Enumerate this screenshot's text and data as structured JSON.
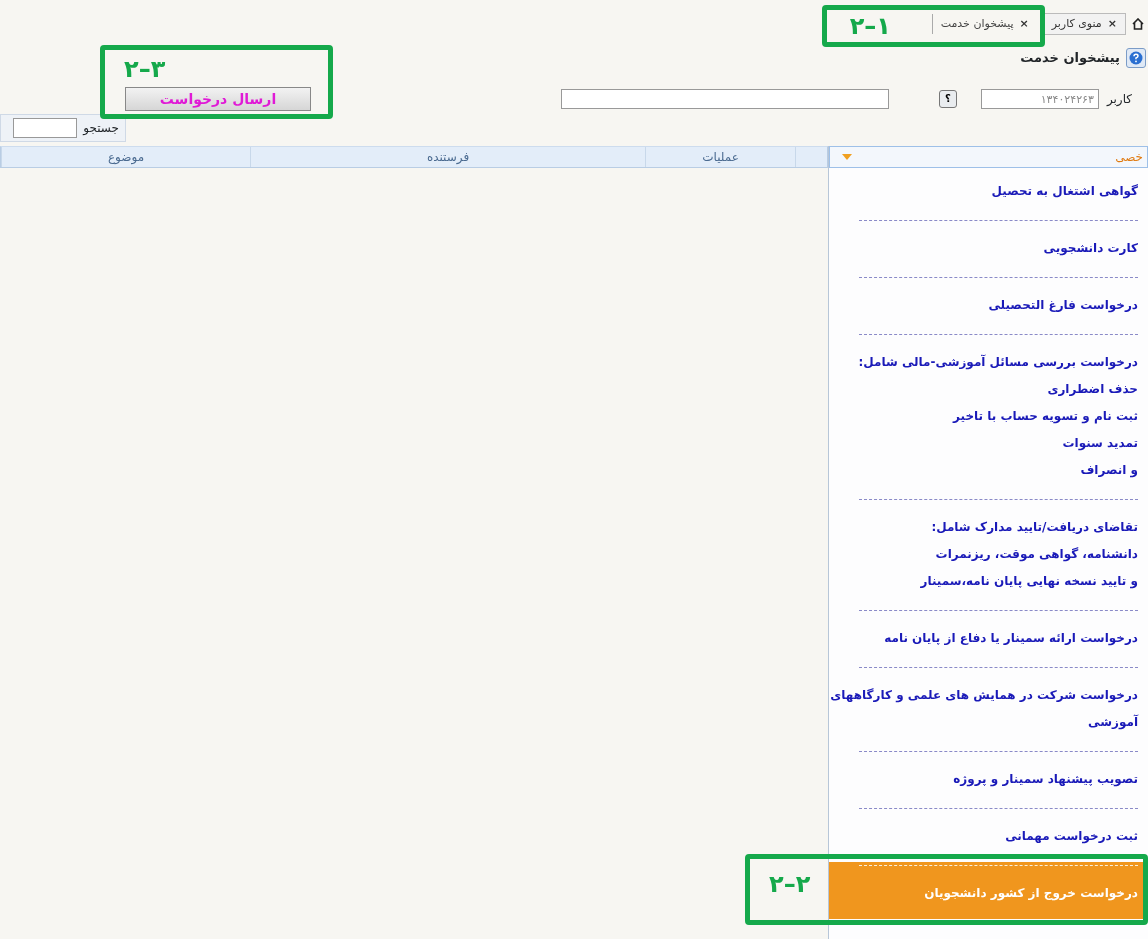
{
  "tabs": [
    {
      "label": "منوی کاربر",
      "close_glyph": "×",
      "selected": false
    },
    {
      "label": "پیشخوان خدمت",
      "close_glyph": "×",
      "selected": true
    }
  ],
  "tabs_annotation": "۲–۱",
  "page_title": "پیشخوان خدمت",
  "user_field": {
    "label": "کاربر",
    "value": "۱۳۴۰۲۴۲۶۳"
  },
  "help_button": "؟",
  "submit_button": {
    "label": "ارسال درخواست",
    "annotation": "۲–۳"
  },
  "search": {
    "label": "جستجو"
  },
  "table": {
    "columns": [
      "عملیات",
      "فرستنده",
      "موضوع"
    ]
  },
  "service_panel": {
    "header": "خصی",
    "expanded": true,
    "items": [
      {
        "lines": [
          "گواهی اشتغال به تحصیل"
        ],
        "selected": false
      },
      {
        "lines": [
          "کارت دانشجویی"
        ],
        "selected": false
      },
      {
        "lines": [
          "درخواست فارغ التحصیلی"
        ],
        "selected": false
      },
      {
        "lines": [
          "درخواست بررسی مسائل آموزشی-مالی شامل:",
          "حذف اضطراری",
          "ثبت نام و تسویه حساب با تاخیر",
          "تمدید سنوات",
          "و انصراف"
        ],
        "selected": false
      },
      {
        "lines": [
          "تقاضای دریافت/تایید مدارک شامل:",
          "دانشنامه، گواهی موقت، ریزنمرات",
          "و تایید نسخه نهایی پایان نامه،سمینار"
        ],
        "selected": false
      },
      {
        "lines": [
          "درخواست ارائه سمینار یا دفاع از پایان نامه"
        ],
        "selected": false
      },
      {
        "lines": [
          "درخواست شرکت در همایش های علمی و کارگاههای",
          "آموزشی"
        ],
        "selected": false
      },
      {
        "lines": [
          "تصویب پیشنهاد سمینار و پروژه"
        ],
        "selected": false
      },
      {
        "lines": [
          "ثبت درخواست مهمانی"
        ],
        "selected": false
      },
      {
        "lines": [
          "درخواست خروج از کشور دانشجویان"
        ],
        "selected": true,
        "annotation": "۲–۲"
      }
    ]
  }
}
